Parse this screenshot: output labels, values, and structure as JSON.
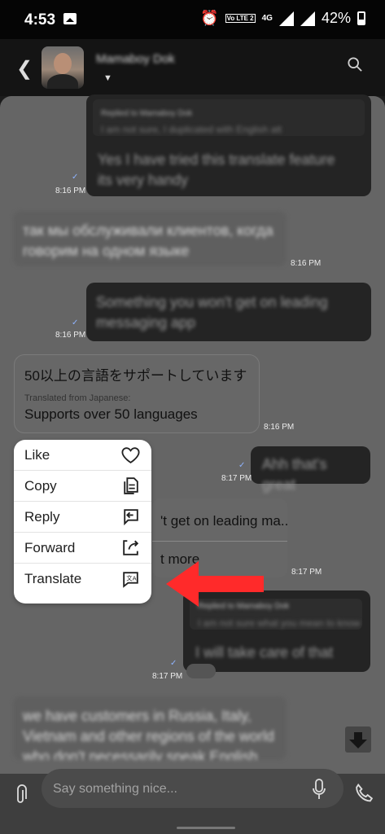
{
  "status_bar": {
    "time": "4:53",
    "network": "4G",
    "volte": "Vo LTE 2",
    "battery": "42%"
  },
  "header": {
    "contact_name": "Mamaboy Dok"
  },
  "messages": [
    {
      "reply_label": "Replied to Mamaboy Dok",
      "reply_preview": "I am not sure, I duplicated with English att",
      "text": "Yes I have tried this translate feature its very handy",
      "time": "8:16 PM"
    },
    {
      "text": "так мы обслуживали клиентов, когда говорим на одном языке",
      "time": "8:16 PM"
    },
    {
      "text": "Something you won't get on leading messaging app",
      "time": "8:16 PM"
    },
    {
      "original": "50以上の言語をサポートしています",
      "translated_label": "Translated from Japanese:",
      "translation": "Supports over 50 languages",
      "time": "8:16 PM"
    },
    {
      "text": "Ahh that's great",
      "time": "8:17 PM"
    },
    {
      "preview_text": "'t get on leading ma...",
      "preview_more": "t more",
      "time": "8:17 PM"
    },
    {
      "reply_label": "Replied to Mamaboy Dok",
      "reply_preview": "I am not sure what you mean to know",
      "text": "I will take care of that",
      "time": "8:17 PM"
    },
    {
      "text": "we have customers in Russia, Italy, Vietnam and other regions of the world who don't necessarily speak English"
    }
  ],
  "context_menu": {
    "items": [
      {
        "label": "Like",
        "icon": "heart-icon"
      },
      {
        "label": "Copy",
        "icon": "copy-icon"
      },
      {
        "label": "Reply",
        "icon": "reply-icon"
      },
      {
        "label": "Forward",
        "icon": "forward-icon"
      },
      {
        "label": "Translate",
        "icon": "translate-icon"
      }
    ]
  },
  "composer": {
    "placeholder": "Say something nice..."
  },
  "colors": {
    "arrow": "#ff2a2a",
    "tick": "#8fb4ff",
    "menu_bg": "#ffffff"
  }
}
